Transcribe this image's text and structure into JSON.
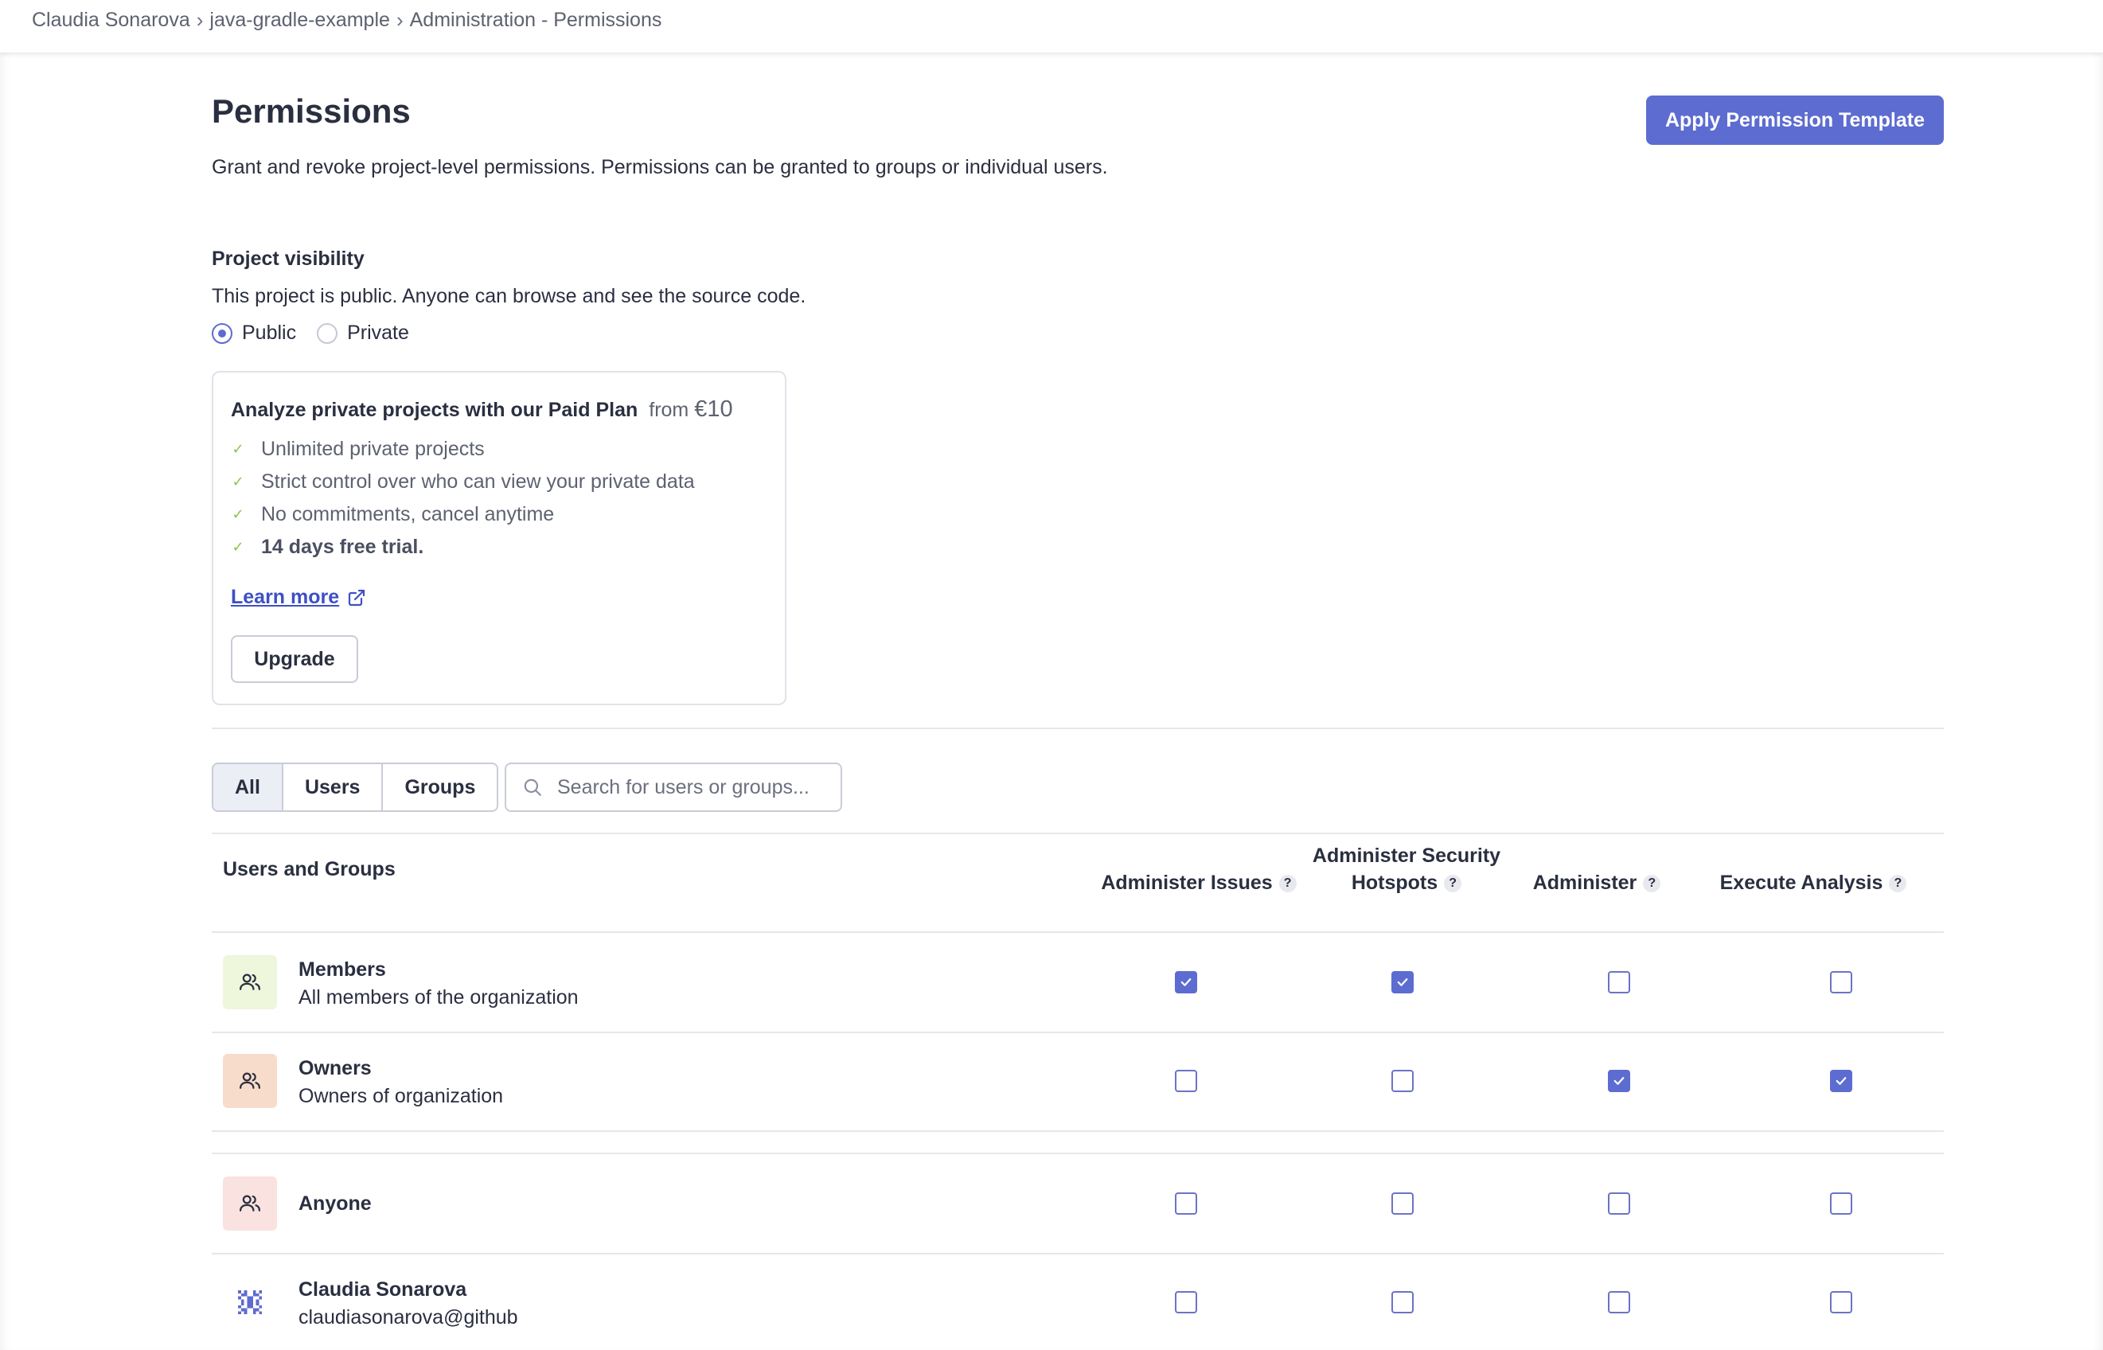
{
  "breadcrumb": {
    "items": [
      "Claudia Sonarova",
      "java-gradle-example",
      "Administration - Permissions"
    ]
  },
  "header": {
    "title": "Permissions",
    "apply_template_label": "Apply Permission Template",
    "description": "Grant and revoke project-level permissions. Permissions can be granted to groups or individual users."
  },
  "visibility": {
    "title": "Project visibility",
    "description": "This project is public. Anyone can browse and see the source code.",
    "options": [
      "Public",
      "Private"
    ],
    "selected": "Public"
  },
  "upsell": {
    "title": "Analyze private projects with our Paid Plan",
    "price_prefix": "from",
    "price": "€10",
    "features": [
      "Unlimited private projects",
      "Strict control over who can view your private data",
      "No commitments, cancel anytime",
      "14 days free trial."
    ],
    "learn_more": "Learn more",
    "upgrade_label": "Upgrade"
  },
  "filters": {
    "tabs": [
      "All",
      "Users",
      "Groups"
    ],
    "active": "All",
    "search_placeholder": "Search for users or groups..."
  },
  "table": {
    "name_header": "Users and Groups",
    "columns": [
      "Administer Issues",
      "Administer Security Hotspots",
      "Administer",
      "Execute Analysis"
    ],
    "rows": [
      {
        "name": "Members",
        "desc": "All members of the organization",
        "avatar": "group-icon",
        "avatar_bg": "#eef6dc",
        "perms": [
          true,
          true,
          false,
          false
        ]
      },
      {
        "name": "Owners",
        "desc": "Owners of organization",
        "avatar": "group-icon",
        "avatar_bg": "#f8dccb",
        "perms": [
          false,
          false,
          true,
          true
        ]
      },
      {
        "name": "Anyone",
        "desc": "",
        "avatar": "group-icon",
        "avatar_bg": "#f9e2e0",
        "perms": [
          false,
          false,
          false,
          false
        ]
      },
      {
        "name": "Claudia Sonarova",
        "desc": "claudiasonarova@github",
        "avatar": "user-avatar",
        "avatar_bg": "#ffffff",
        "perms": [
          false,
          false,
          false,
          false
        ]
      }
    ]
  },
  "colors": {
    "accent": "#5d6cd0",
    "link": "#3e4fc4",
    "check_green": "#8bc34a"
  }
}
